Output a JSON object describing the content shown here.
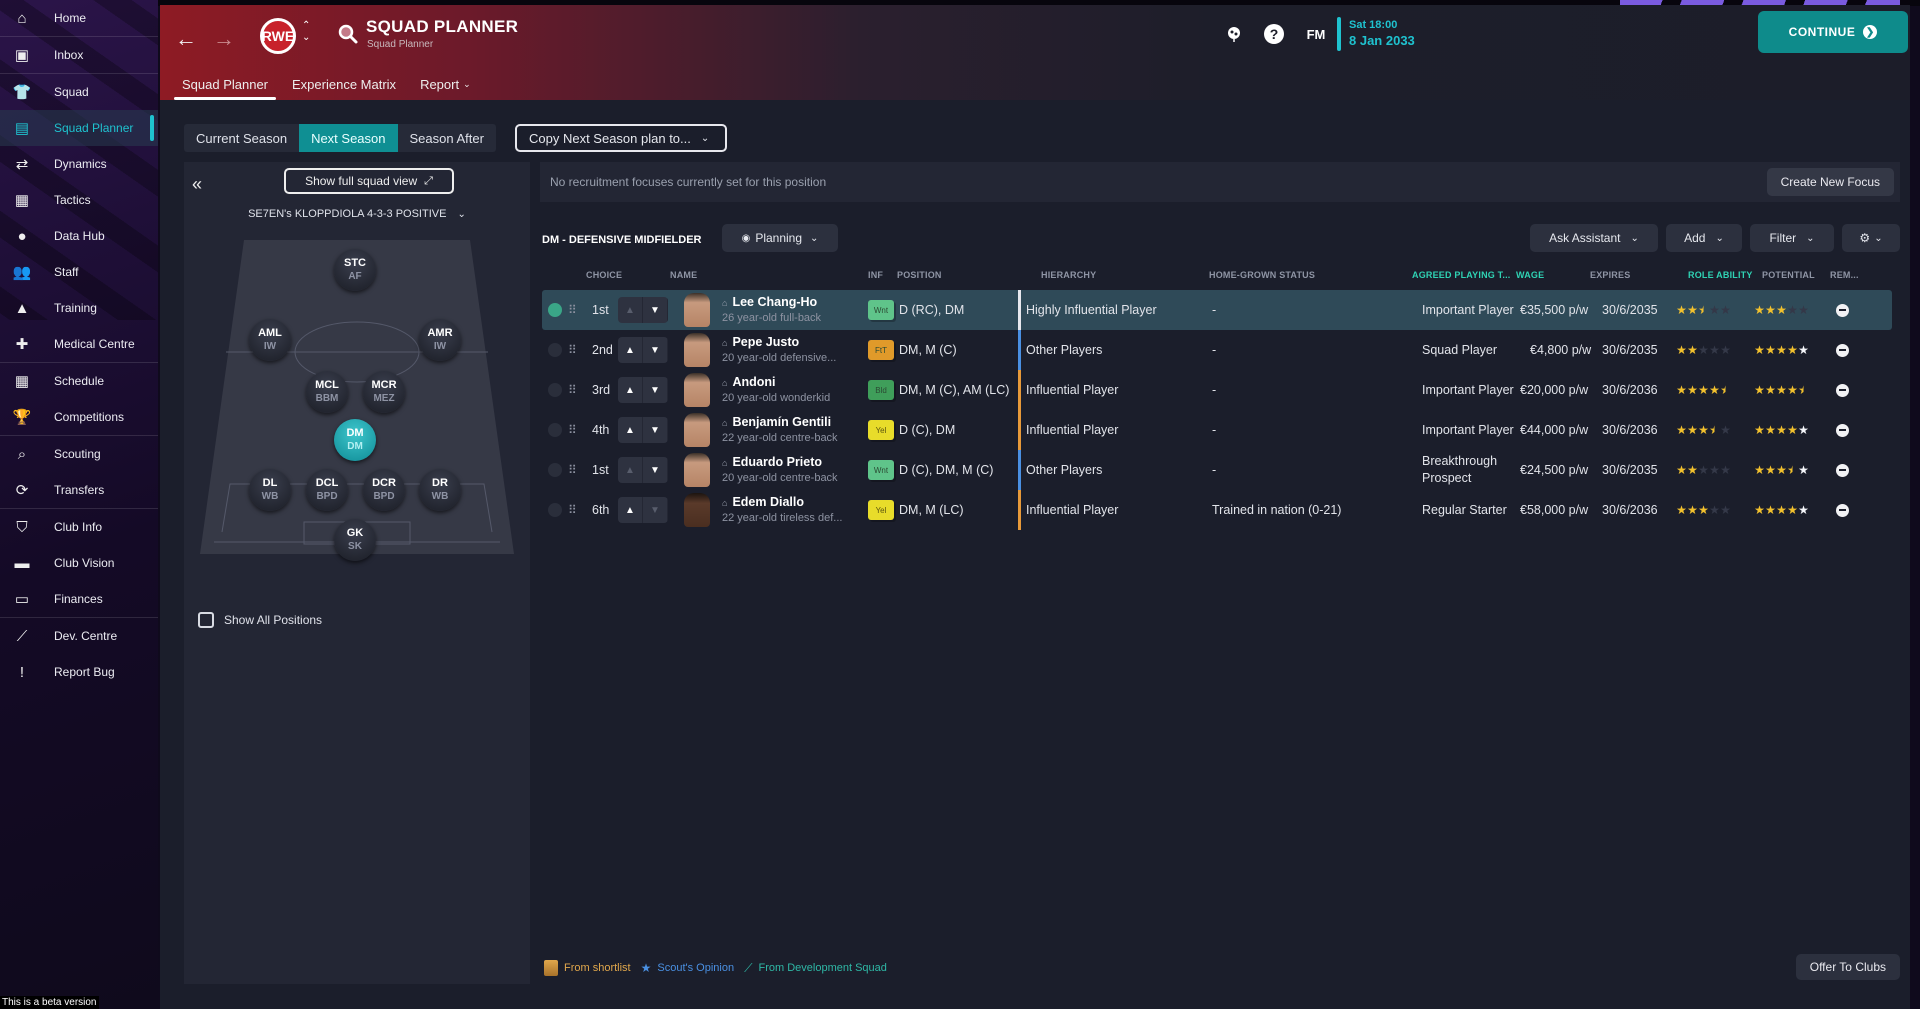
{
  "sidebar": {
    "items": [
      {
        "label": "Home",
        "icon": "home-icon",
        "glyph": "⌂"
      },
      {
        "label": "Inbox",
        "icon": "inbox-icon",
        "glyph": "▣"
      },
      {
        "label": "Squad",
        "icon": "shirt-icon",
        "glyph": "👕"
      },
      {
        "label": "Squad Planner",
        "icon": "clipboard-icon",
        "glyph": "▤",
        "active": true
      },
      {
        "label": "Dynamics",
        "icon": "dynamics-icon",
        "glyph": "⇄"
      },
      {
        "label": "Tactics",
        "icon": "tactics-icon",
        "glyph": "▦"
      },
      {
        "label": "Data Hub",
        "icon": "data-hub-icon",
        "glyph": "●"
      },
      {
        "label": "Staff",
        "icon": "staff-icon",
        "glyph": "👥"
      },
      {
        "label": "Training",
        "icon": "training-icon",
        "glyph": "▲"
      },
      {
        "label": "Medical Centre",
        "icon": "medical-icon",
        "glyph": "✚"
      },
      {
        "label": "Schedule",
        "icon": "calendar-icon",
        "glyph": "▦"
      },
      {
        "label": "Competitions",
        "icon": "trophy-icon",
        "glyph": "🏆"
      },
      {
        "label": "Scouting",
        "icon": "search-icon",
        "glyph": "⌕"
      },
      {
        "label": "Transfers",
        "icon": "transfers-icon",
        "glyph": "⟳"
      },
      {
        "label": "Club Info",
        "icon": "shield-icon",
        "glyph": "⛉"
      },
      {
        "label": "Club Vision",
        "icon": "briefcase-icon",
        "glyph": "▬"
      },
      {
        "label": "Finances",
        "icon": "finances-icon",
        "glyph": "▭"
      },
      {
        "label": "Dev. Centre",
        "icon": "dev-centre-icon",
        "glyph": "⟋"
      },
      {
        "label": "Report Bug",
        "icon": "report-bug-icon",
        "glyph": "!"
      }
    ],
    "beta_label": "This is a beta version"
  },
  "header": {
    "title": "SQUAD PLANNER",
    "subtitle": "Squad Planner",
    "club_badge_text": "RWE",
    "tabs": [
      {
        "label": "Squad Planner",
        "active": true
      },
      {
        "label": "Experience Matrix"
      },
      {
        "label": "Report",
        "dropdown": true
      }
    ],
    "fm_label": "FM",
    "help_label": "?",
    "date_time": "Sat 18:00",
    "date": "8 Jan 2033",
    "continue_label": "CONTINUE"
  },
  "season_tabs": [
    {
      "label": "Current Season"
    },
    {
      "label": "Next Season",
      "active": true
    },
    {
      "label": "Season After"
    }
  ],
  "copy_plan_label": "Copy Next Season plan to...",
  "pitch_panel": {
    "full_squad_label": "Show full squad view",
    "tactic_name": "SE7EN's KLOPPDIOLA 4-3-3 POSITIVE",
    "positions": [
      {
        "pos": "STC",
        "role": "AF"
      },
      {
        "pos": "AML",
        "role": "IW"
      },
      {
        "pos": "AMR",
        "role": "IW"
      },
      {
        "pos": "MCL",
        "role": "BBM"
      },
      {
        "pos": "MCR",
        "role": "MEZ"
      },
      {
        "pos": "DM",
        "role": "DM",
        "active": true
      },
      {
        "pos": "DL",
        "role": "WB"
      },
      {
        "pos": "DCL",
        "role": "BPD"
      },
      {
        "pos": "DCR",
        "role": "BPD"
      },
      {
        "pos": "DR",
        "role": "WB"
      },
      {
        "pos": "GK",
        "role": "SK"
      }
    ],
    "show_all_label": "Show All Positions",
    "show_all_checked": false
  },
  "focus": {
    "message": "No recruitment focuses currently set for this position",
    "create_label": "Create New Focus"
  },
  "position_section": {
    "title": "DM - DEFENSIVE MIDFIELDER",
    "planning_label": "Planning",
    "ask_assistant_label": "Ask Assistant",
    "add_label": "Add",
    "filter_label": "Filter"
  },
  "table": {
    "columns": {
      "choice": "CHOICE",
      "name": "NAME",
      "inf": "INF",
      "position": "POSITION",
      "hierarchy": "HIERARCHY",
      "home_grown": "HOME-GROWN STATUS",
      "agreed": "AGREED PLAYING T...",
      "wage": "WAGE",
      "expires": "EXPIRES",
      "role_ability": "ROLE ABILITY",
      "potential": "POTENTIAL",
      "remove": "REM..."
    },
    "rows": [
      {
        "selected": true,
        "choice": "1st",
        "up_enabled": false,
        "down_enabled": true,
        "name": "Lee Chang-Ho",
        "desc": "26 year-old full-back",
        "inf": "Wnt",
        "inf_color": "#5fc48a",
        "position": "D (RC), DM",
        "hierarchy": "Highly Influential Player",
        "hier_color": "#e8e8ee",
        "home_grown": "-",
        "agreed": "Important Player",
        "wage": "€35,500 p/w",
        "expires": "30/6/2035",
        "role_ability": 2.5,
        "potential_min": 3,
        "potential_max": 3,
        "face": "light"
      },
      {
        "choice": "2nd",
        "up_enabled": true,
        "down_enabled": true,
        "name": "Pepe Justo",
        "desc": "20 year-old defensive...",
        "inf": "FtT",
        "inf_color": "#e09a2a",
        "position": "DM, M (C)",
        "hierarchy": "Other Players",
        "hier_color": "#4a90e2",
        "home_grown": "-",
        "agreed": "Squad Player",
        "wage": "€4,800 p/w",
        "expires": "30/6/2035",
        "role_ability": 2,
        "potential_min": 4,
        "potential_max": 5,
        "face": "light"
      },
      {
        "choice": "3rd",
        "up_enabled": true,
        "down_enabled": true,
        "name": "Andoni",
        "desc": "20 year-old wonderkid",
        "inf": "Bld",
        "inf_color": "#3f9e5a",
        "position": "DM, M (C), AM (LC)",
        "hierarchy": "Influential Player",
        "hier_color": "#e89a3a",
        "home_grown": "-",
        "agreed": "Important Player",
        "wage": "€20,000 p/w",
        "expires": "30/6/2036",
        "role_ability": 4.5,
        "potential_min": 4.5,
        "potential_max": 5,
        "face": "light"
      },
      {
        "choice": "4th",
        "up_enabled": true,
        "down_enabled": true,
        "name": "Benjamín Gentili",
        "desc": "22 year-old centre-back",
        "inf": "Yel",
        "inf_color": "#e8dc2a",
        "position": "D (C), DM",
        "hierarchy": "Influential Player",
        "hier_color": "#e89a3a",
        "home_grown": "-",
        "agreed": "Important Player",
        "wage": "€44,000 p/w",
        "expires": "30/6/2036",
        "role_ability": 3.5,
        "potential_min": 4,
        "potential_max": 5,
        "face": "light"
      },
      {
        "choice": "1st",
        "up_enabled": false,
        "down_enabled": true,
        "name": "Eduardo Prieto",
        "desc": "20 year-old centre-back",
        "inf": "Wnt",
        "inf_color": "#5fc48a",
        "position": "D (C), DM, M (C)",
        "hierarchy": "Other Players",
        "hier_color": "#4a90e2",
        "home_grown": "-",
        "agreed": "Breakthrough Prospect",
        "wage": "€24,500 p/w",
        "expires": "30/6/2035",
        "role_ability": 2,
        "potential_min": 3.5,
        "potential_max": 4.5,
        "face": "light"
      },
      {
        "choice": "6th",
        "up_enabled": true,
        "down_enabled": false,
        "name": "Edem Diallo",
        "desc": "22 year-old tireless def...",
        "inf": "Yel",
        "inf_color": "#e8dc2a",
        "position": "DM, M (LC)",
        "hierarchy": "Influential Player",
        "hier_color": "#e89a3a",
        "home_grown": "Trained in nation (0-21)",
        "agreed": "Regular Starter",
        "wage": "€58,000 p/w",
        "expires": "30/6/2036",
        "role_ability": 3,
        "potential_min": 4,
        "potential_max": 5,
        "face": "dark"
      }
    ]
  },
  "legend": {
    "shortlist": "From shortlist",
    "scout": "Scout's Opinion",
    "dev": "From Development Squad"
  },
  "offer_label": "Offer To Clubs",
  "colors": {
    "accent": "#1fc2cf",
    "continue": "#0e8b8b",
    "active_tab": "#0f8f93"
  }
}
